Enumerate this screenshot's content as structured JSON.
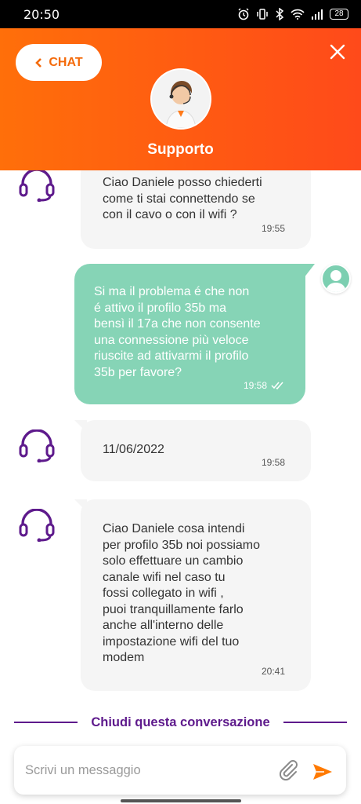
{
  "status_bar": {
    "time": "20:50",
    "battery": "28"
  },
  "header": {
    "back_label": "CHAT",
    "title": "Supporto"
  },
  "messages": [
    {
      "from": "agent",
      "text": "Ciao Daniele posso chiederti\ncome ti stai connettendo se\ncon il cavo o con il wifi ?",
      "time": "19:55"
    },
    {
      "from": "user",
      "text": "Si ma il problema é che non\né attivo il profilo 35b ma\nbensì il 17a che non consente\nuna connessione più veloce\nriuscite ad attivarmi il profilo\n35b per favore?",
      "time": "19:58"
    },
    {
      "from": "agent",
      "text": "11/06/2022",
      "time": "19:58"
    },
    {
      "from": "agent",
      "text": "Ciao Daniele cosa intendi\nper profilo 35b noi possiamo\nsolo effettuare un cambio\ncanale wifi nel caso tu\nfossi collegato in wifi ,\npuoi tranquillamente farlo\nanche all'interno delle\nimpostazione wifi del tuo\nmodem",
      "time": "20:41"
    }
  ],
  "close_conversation": "Chiudi questa conversazione",
  "composer": {
    "placeholder": "Scrivi un messaggio"
  },
  "colors": {
    "header": "#ff5a12",
    "accent_purple": "#5e1a8c",
    "user_bubble": "#86d4b6",
    "agent_bubble": "#f5f5f5",
    "send": "#ff7a00"
  },
  "icons": [
    "alarm-icon",
    "vibrate-icon",
    "bluetooth-icon",
    "wifi-icon",
    "signal-icon",
    "battery-icon",
    "chevron-left-icon",
    "close-icon",
    "headset-icon",
    "user-icon",
    "paperclip-icon",
    "send-icon"
  ]
}
